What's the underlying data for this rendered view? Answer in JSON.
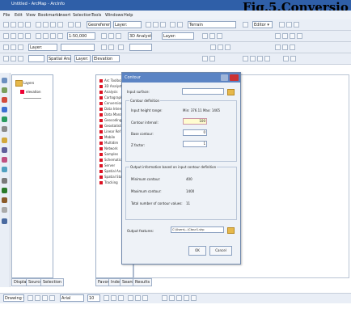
{
  "page_header": "Fig.5.Conversio",
  "app": {
    "title": "Untitled - ArcMap - ArcInfo"
  },
  "menu": {
    "items": [
      "File",
      "Edit",
      "View",
      "Bookmarks",
      "Insert",
      "Selection",
      "Tools",
      "Windows",
      "Help"
    ]
  },
  "toolbar1": {
    "georef_label": "Georeferencing ▾",
    "layer_value": "Layer:",
    "target_value": "Terrain",
    "editor_label": "Editor ▾"
  },
  "toolbar2": {
    "scale_value": "1:50,000",
    "3d_label": "3D Analyst ▾",
    "layer_value": "Layer:"
  },
  "toolbar3": {
    "spatial_label": "Spatial Analyst ▾",
    "layer_value": "Layer:",
    "layer_field": "Elevation"
  },
  "toc": {
    "title": "Layers",
    "layer_name": "elevation"
  },
  "toc_tabs": [
    "Display",
    "Source",
    "Selection"
  ],
  "catalog": {
    "root": "Arc Toolbox",
    "items": [
      "3D Analyst",
      "Analysis",
      "Cartography",
      "Conversion",
      "Data Interop",
      "Data Management",
      "Geocoding",
      "Geostatistical",
      "Linear Ref",
      "Mobile",
      "Multidim",
      "Network",
      "Samples",
      "Schematics",
      "Server",
      "Spatial Analyst",
      "Spatial Stats",
      "Tracking"
    ]
  },
  "catalog_tabs": [
    "Favorites",
    "Index",
    "Search",
    "Results"
  ],
  "dialog": {
    "title": "Contour",
    "input_surface_label": "Input surface:",
    "contour_def_label": "Contour definition",
    "input_height_label": "Input height range:",
    "input_height_value": "Min: 376.11 Max: 1465",
    "contour_interval_label": "Contour interval:",
    "contour_interval_value": "100",
    "base_contour_label": "Base contour:",
    "base_contour_value": "0",
    "z_factor_label": "Z factor:",
    "z_factor_value": "1",
    "output_info_label": "Output information based on input contour definition",
    "min_contour_label": "Minimum contour:",
    "min_contour_value": "400",
    "max_contour_label": "Maximum contour:",
    "max_contour_value": "1400",
    "total_label": "Total number of contour values:",
    "total_value": "11",
    "output_features_label": "Output features:",
    "output_features_value": "C:\\Users\\...\\Ctour1.shp",
    "ok_label": "OK",
    "cancel_label": "Cancel"
  },
  "status": {
    "drawing_label": "Drawing ▾",
    "font_value": "Arial",
    "size_value": "10"
  }
}
